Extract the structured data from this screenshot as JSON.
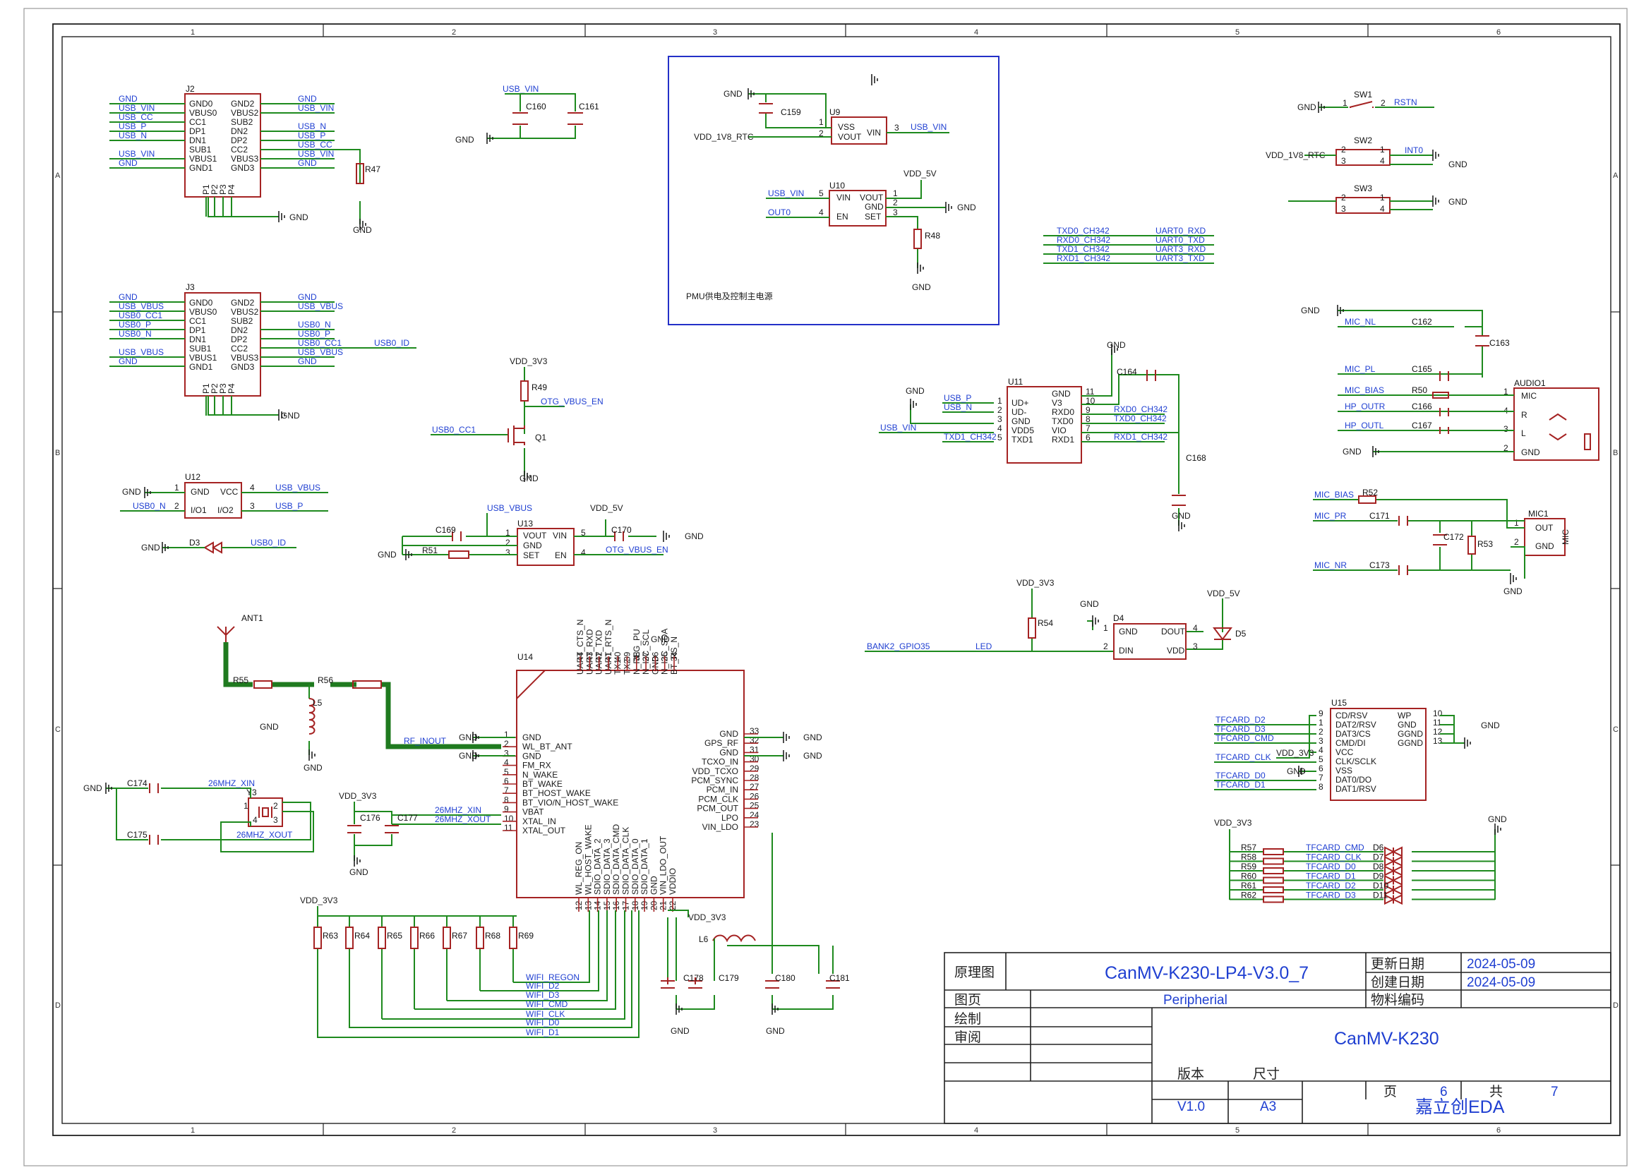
{
  "frame": {
    "col_labels": [
      "1",
      "2",
      "3",
      "4",
      "5",
      "6"
    ],
    "row_labels": [
      "A",
      "B",
      "C",
      "D"
    ]
  },
  "title_block": {
    "schematic_label": "原理图",
    "project": "CanMV-K230-LP4-V3.0_7",
    "update_label": "更新日期",
    "update_date": "2024-05-09",
    "create_label": "创建日期",
    "create_date": "2024-05-09",
    "page_label": "图页",
    "page_name": "Peripherial",
    "part_label": "物料编码",
    "drawn_label": "绘制",
    "review_label": "审阅",
    "board": "CanMV-K230",
    "version_label": "版本",
    "version": "V1.0",
    "size_label": "尺寸",
    "size": "A3",
    "sheet_label": "页",
    "sheet_no": "6",
    "total_label": "共",
    "total": "7",
    "tool": "嘉立创EDA"
  },
  "pmu_box": {
    "note": "PMU供电及控制主电源"
  },
  "parts": {
    "J2": {
      "ref": "J2",
      "left": [
        "GND0",
        "VBUS0",
        "CC1",
        "DP1",
        "DN1",
        "SUB1",
        "VBUS1",
        "GND1"
      ],
      "right": [
        "GND2",
        "VBUS2",
        "SUB2",
        "DN2",
        "DP2",
        "CC2",
        "VBUS3",
        "GND3"
      ],
      "bottom": [
        "P1",
        "P2",
        "P3",
        "P4"
      ]
    },
    "J3": {
      "ref": "J3",
      "left": [
        "GND0",
        "VBUS0",
        "CC1",
        "DP1",
        "DN1",
        "SUB1",
        "VBUS1",
        "GND1"
      ],
      "right": [
        "GND2",
        "VBUS2",
        "SUB2",
        "DN2",
        "DP2",
        "CC2",
        "VBUS3",
        "GND3"
      ],
      "bottom": [
        "P1",
        "P2",
        "P3",
        "P4"
      ]
    },
    "U9": {
      "ref": "U9",
      "pins": [
        "VSS",
        "VOUT",
        "VIN"
      ],
      "nums": [
        "1",
        "2",
        "3"
      ]
    },
    "U10": {
      "ref": "U10",
      "pins": [
        "VIN",
        "EN",
        "VOUT",
        "GND",
        "SET"
      ],
      "nums": [
        "5",
        "4",
        "1",
        "2",
        "3"
      ]
    },
    "U11": {
      "ref": "U11",
      "left": [
        "UD+",
        "UD-",
        "GND",
        "VDD5",
        "TXD1"
      ],
      "left_nums": [
        "1",
        "2",
        "3",
        "4",
        "5"
      ],
      "right": [
        "GND",
        "V3",
        "RXD0",
        "TXD0",
        "VIO",
        "RXD1"
      ],
      "right_nums": [
        "11",
        "10",
        "9",
        "8",
        "7",
        "6"
      ]
    },
    "U12": {
      "ref": "U12",
      "pins": [
        "GND",
        "VCC",
        "I/O1",
        "I/O2"
      ],
      "nums": [
        "1",
        "4",
        "2",
        "3"
      ]
    },
    "U13": {
      "ref": "U13",
      "pins": [
        "VOUT",
        "GND",
        "SET",
        "VIN",
        "EN"
      ],
      "nums": [
        "1",
        "2",
        "3",
        "5",
        "4"
      ]
    },
    "U14": {
      "ref": "U14",
      "left": [
        "GND",
        "WL_BT_ANT",
        "GND",
        "FM_RX",
        "N_WAKE",
        "BT_WAKE",
        "BT_HOST_WAKE",
        "BT_VIO/N_HOST_WAKE",
        "VBAT",
        "XTAL_IN",
        "XTAL_OUT"
      ],
      "left_nums": [
        "1",
        "2",
        "3",
        "4",
        "5",
        "6",
        "7",
        "8",
        "9",
        "10",
        "11"
      ],
      "right": [
        "GND",
        "GPS_RF",
        "GND",
        "TCXO_IN",
        "VDD_TCXO",
        "PCM_SYNC",
        "PCM_IN",
        "PCM_CLK",
        "PCM_OUT",
        "LPO",
        "VIN_LDO"
      ],
      "right_nums": [
        "33",
        "32",
        "31",
        "30",
        "29",
        "28",
        "27",
        "26",
        "25",
        "24",
        "23"
      ],
      "top": [
        "UART_CTS_N",
        "UART_RXD",
        "UART_TXD",
        "UART_RTS_N",
        "TX1",
        "TX2",
        "N_REG_PU",
        "N_I2C_SCL",
        "GND",
        "N_I2C_SDA",
        "BT_RS_N"
      ],
      "top_nums": [
        "44",
        "43",
        "42",
        "41",
        "40",
        "39",
        "38",
        "37",
        "36",
        "35",
        "34"
      ],
      "bottom": [
        "WL_REG_ON",
        "WL_HOST_WAKE",
        "SDIO_DATA_2",
        "SDIO_DATA_3",
        "SDIO_DATA_CMD",
        "SDIO_DATA_CLK",
        "SDIO_DATA_0",
        "SDIO_DATA_1",
        "GND",
        "VIN_LDO_OUT",
        "VDDIO"
      ],
      "bottom_nums": [
        "12",
        "13",
        "14",
        "15",
        "16",
        "17",
        "18",
        "19",
        "20",
        "21",
        "22"
      ]
    },
    "U15": {
      "ref": "U15",
      "left": [
        "CD/RSV",
        "DAT2/RSV",
        "DAT3/CS",
        "CMD/DI",
        "VCC",
        "CLK/SCLK",
        "VSS",
        "DAT0/DO",
        "DAT1/RSV"
      ],
      "left_nums": [
        "9",
        "1",
        "2",
        "3",
        "4",
        "5",
        "6",
        "7",
        "8"
      ],
      "right": [
        "WP",
        "GND",
        "GGND",
        "GGND"
      ],
      "right_nums": [
        "10",
        "11",
        "12",
        "13"
      ]
    },
    "AUDIO1": {
      "ref": "AUDIO1",
      "pins": [
        "MIC",
        "R",
        "L",
        "GND"
      ],
      "nums": [
        "1",
        "4",
        "3",
        "2"
      ]
    },
    "MIC1": {
      "ref": "MIC1",
      "pins": [
        "OUT",
        "GND"
      ],
      "nums": [
        "1",
        "2"
      ],
      "body": "MIC"
    },
    "D4": {
      "ref": "D4",
      "pins": [
        "GND",
        "DIN",
        "DOUT",
        "VDD"
      ],
      "nums": [
        "1",
        "2",
        "4",
        "3"
      ]
    },
    "SW1": {
      "ref": "SW1",
      "nums": [
        "1",
        "2"
      ]
    },
    "SW2": {
      "ref": "SW2",
      "nums": [
        "2",
        "1",
        "3",
        "4"
      ]
    },
    "SW3": {
      "ref": "SW3",
      "nums": [
        "2",
        "1",
        "3",
        "4"
      ]
    },
    "Y3": {
      "ref": "Y3",
      "nums": [
        "1",
        "2",
        "3",
        "4"
      ]
    }
  },
  "refs": {
    "C159": "C159",
    "C160": "C160",
    "C161": "C161",
    "C162": "C162",
    "C163": "C163",
    "C164": "C164",
    "C165": "C165",
    "C166": "C166",
    "C167": "C167",
    "C168": "C168",
    "C169": "C169",
    "C170": "C170",
    "C171": "C171",
    "C172": "C172",
    "C173": "C173",
    "C174": "C174",
    "C175": "C175",
    "C176": "C176",
    "C177": "C177",
    "C178": "C178",
    "C179": "C179",
    "C180": "C180",
    "C181": "C181",
    "R47": "R47",
    "R48": "R48",
    "R49": "R49",
    "R50": "R50",
    "R51": "R51",
    "R52": "R52",
    "R53": "R53",
    "R54": "R54",
    "R55": "R55",
    "R56": "R56",
    "R57": "R57",
    "R58": "R58",
    "R59": "R59",
    "R60": "R60",
    "R61": "R61",
    "R62": "R62",
    "R63": "R63",
    "R64": "R64",
    "R65": "R65",
    "R66": "R66",
    "R67": "R67",
    "R68": "R68",
    "R69": "R69",
    "Q1": "Q1",
    "D3": "D3",
    "D5": "D5",
    "D6": "D6",
    "D7": "D7",
    "D8": "D8",
    "D9": "D9",
    "D10": "D10",
    "D11": "D11",
    "L5": "L5",
    "L6": "L6",
    "ANT1": "ANT1"
  },
  "nets": {
    "gnd": "GND",
    "usb_vin": "USB_VIN",
    "usb_cc": "USB_CC",
    "usb_p": "USB_P",
    "usb_n": "USB_N",
    "usb_vbus": "USB_VBUS",
    "usb0_cc1": "USB0_CC1",
    "usb0_p": "USB0_P",
    "usb0_n": "USB0_N",
    "usb0_id": "USB0_ID",
    "vdd_1v8_rtc": "VDD_1V8_RTC",
    "vdd_5v": "VDD_5V",
    "vdd_3v3": "VDD_3V3",
    "out0": "OUT0",
    "otg_vbus_en": "OTG_VBUS_EN",
    "rstn": "RSTN",
    "int0": "INT0",
    "txd0_ch342": "TXD0_CH342",
    "rxd0_ch342": "RXD0_CH342",
    "txd1_ch342": "TXD1_CH342",
    "rxd1_ch342": "RXD1_CH342",
    "uart0_rxd": "UART0_RXD",
    "uart0_txd": "UART0_TXD",
    "uart3_rxd": "UART3_RXD",
    "uart3_txd": "UART3_TXD",
    "mic_nl": "MIC_NL",
    "mic_pl": "MIC_PL",
    "mic_bias": "MIC_BIAS",
    "hp_outr": "HP_OUTR",
    "hp_outl": "HP_OUTL",
    "mic_pr": "MIC_PR",
    "mic_nr": "MIC_NR",
    "bank2_gpio35": "BANK2_GPIO35",
    "led": "LED",
    "rf_inout": "RF_INOUT",
    "x26_in": "26MHZ_XIN",
    "x26_out": "26MHZ_XOUT",
    "tf_d2": "TFCARD_D2",
    "tf_d3": "TFCARD_D3",
    "tf_cmd": "TFCARD_CMD",
    "tf_clk": "TFCARD_CLK",
    "tf_d0": "TFCARD_D0",
    "tf_d1": "TFCARD_D1",
    "wifi_regon": "WIFI_REGON",
    "wifi_d2": "WIFI_D2",
    "wifi_d3": "WIFI_D3",
    "wifi_cmd": "WIFI_CMD",
    "wifi_clk": "WIFI_CLK",
    "wifi_d0": "WIFI_D0",
    "wifi_d1": "WIFI_D1"
  },
  "colors": {
    "symbol": "#a52323",
    "wire": "#1e8a1e",
    "net": "#1f3fd1",
    "frame": "#222222"
  }
}
